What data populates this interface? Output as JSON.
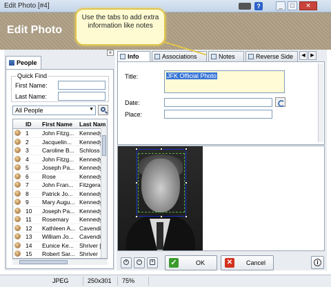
{
  "window": {
    "title": "Edit Photo [#4]"
  },
  "header": {
    "title": "Edit Photo"
  },
  "callout": {
    "text": "Use the tabs to add extra information like notes"
  },
  "people": {
    "tab_label": "People",
    "quick_find_label": "Quick Find",
    "first_name_label": "First Name:",
    "last_name_label": "Last Name:",
    "first_name_value": "",
    "last_name_value": "",
    "filter_value": "All People",
    "columns": [
      "ID",
      "First Name",
      "Last Nam"
    ],
    "rows": [
      {
        "id": "1",
        "first": "John Fitzg...",
        "last": "Kennedy"
      },
      {
        "id": "2",
        "first": "Jacquelin...",
        "last": "Kennedy"
      },
      {
        "id": "3",
        "first": "Caroline B...",
        "last": "Schloss"
      },
      {
        "id": "4",
        "first": "John Fitzg...",
        "last": "Kennedy"
      },
      {
        "id": "5",
        "first": "Joseph Pa...",
        "last": "Kennedy"
      },
      {
        "id": "6",
        "first": "Rose",
        "last": "Kennedy"
      },
      {
        "id": "7",
        "first": "John Fran...",
        "last": "Fitzgeral"
      },
      {
        "id": "8",
        "first": "Patrick Jo...",
        "last": "Kennedy"
      },
      {
        "id": "9",
        "first": "Mary Augu...",
        "last": "Kennedy"
      },
      {
        "id": "10",
        "first": "Joseph Pa...",
        "last": "Kennedy"
      },
      {
        "id": "11",
        "first": "Rosemary",
        "last": "Kennedy"
      },
      {
        "id": "12",
        "first": "Kathleen A...",
        "last": "Cavendi"
      },
      {
        "id": "13",
        "first": "William Jo...",
        "last": "Cavendi"
      },
      {
        "id": "14",
        "first": "Eunice Ke...",
        "last": "Shriver [I"
      },
      {
        "id": "15",
        "first": "Robert Sar...",
        "last": "Shriver"
      }
    ]
  },
  "tabs": [
    {
      "label": "Info"
    },
    {
      "label": "Associations"
    },
    {
      "label": "Notes"
    },
    {
      "label": "Reverse Side"
    }
  ],
  "info": {
    "title_label": "Title:",
    "title_value": "JFK Official Photo",
    "date_label": "Date:",
    "date_value": "",
    "place_label": "Place:",
    "place_value": ""
  },
  "buttons": {
    "ok": "OK",
    "cancel": "Cancel"
  },
  "status": {
    "format": "JPEG",
    "dimensions": "250x301",
    "zoom": "75%"
  }
}
